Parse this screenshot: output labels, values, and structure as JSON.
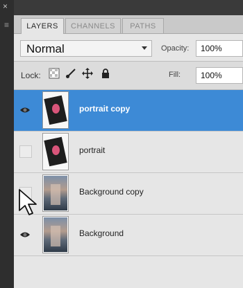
{
  "window": {
    "close_glyph": "×",
    "grip_glyph": "≡"
  },
  "tabs": [
    {
      "label": "LAYERS",
      "active": true
    },
    {
      "label": "CHANNELS",
      "active": false
    },
    {
      "label": "PATHS",
      "active": false
    }
  ],
  "controls": {
    "blend_mode": "Normal",
    "opacity_label": "Opacity:",
    "opacity_value": "100%",
    "lock_label": "Lock:",
    "fill_label": "Fill:",
    "fill_value": "100%"
  },
  "lock_icons": [
    "lock-transparency-icon",
    "brush-icon",
    "move-icon",
    "lock-icon"
  ],
  "layers": [
    {
      "name": "portrait copy",
      "visible": true,
      "selected": true,
      "thumb": "portrait"
    },
    {
      "name": "portrait",
      "visible": false,
      "selected": false,
      "thumb": "portrait"
    },
    {
      "name": "Background copy",
      "visible": false,
      "selected": false,
      "thumb": "background"
    },
    {
      "name": "Background",
      "visible": true,
      "selected": false,
      "thumb": "background"
    }
  ],
  "colors": {
    "selection": "#3d8ad6",
    "panel": "#e6e6e6",
    "dark_chrome": "#2b2b2b"
  }
}
